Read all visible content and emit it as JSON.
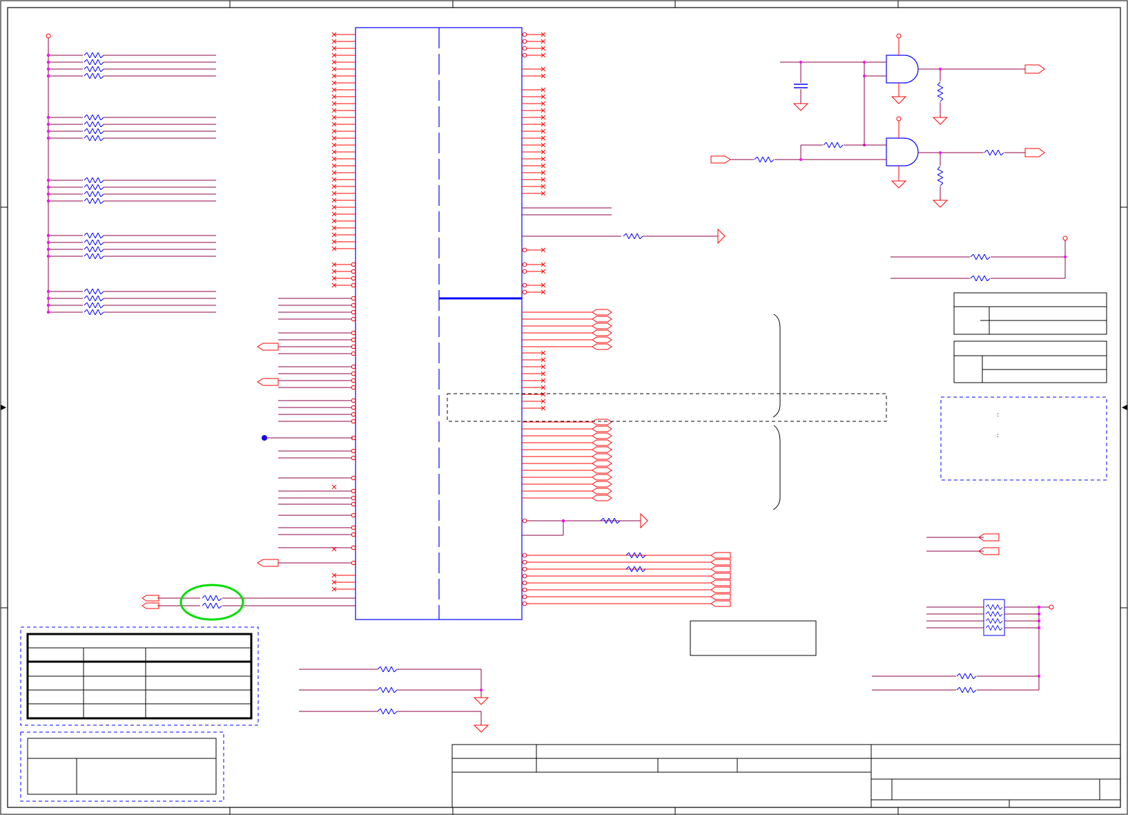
{
  "schematic": {
    "colors": {
      "wire": "#8b0046",
      "pin": "#ff0000",
      "part": "#0000ff",
      "junction": "#ff00ff",
      "highlight": "#00dd00",
      "frame": "#000000"
    },
    "ic": {
      "pin_colons": [
        ":",
        ":"
      ]
    },
    "title_block": {},
    "icons": [
      "resistor-icon",
      "capacitor-icon",
      "ground-icon",
      "and-gate-icon",
      "offpage-connector-icon",
      "power-port-icon",
      "no-connect-icon"
    ]
  }
}
